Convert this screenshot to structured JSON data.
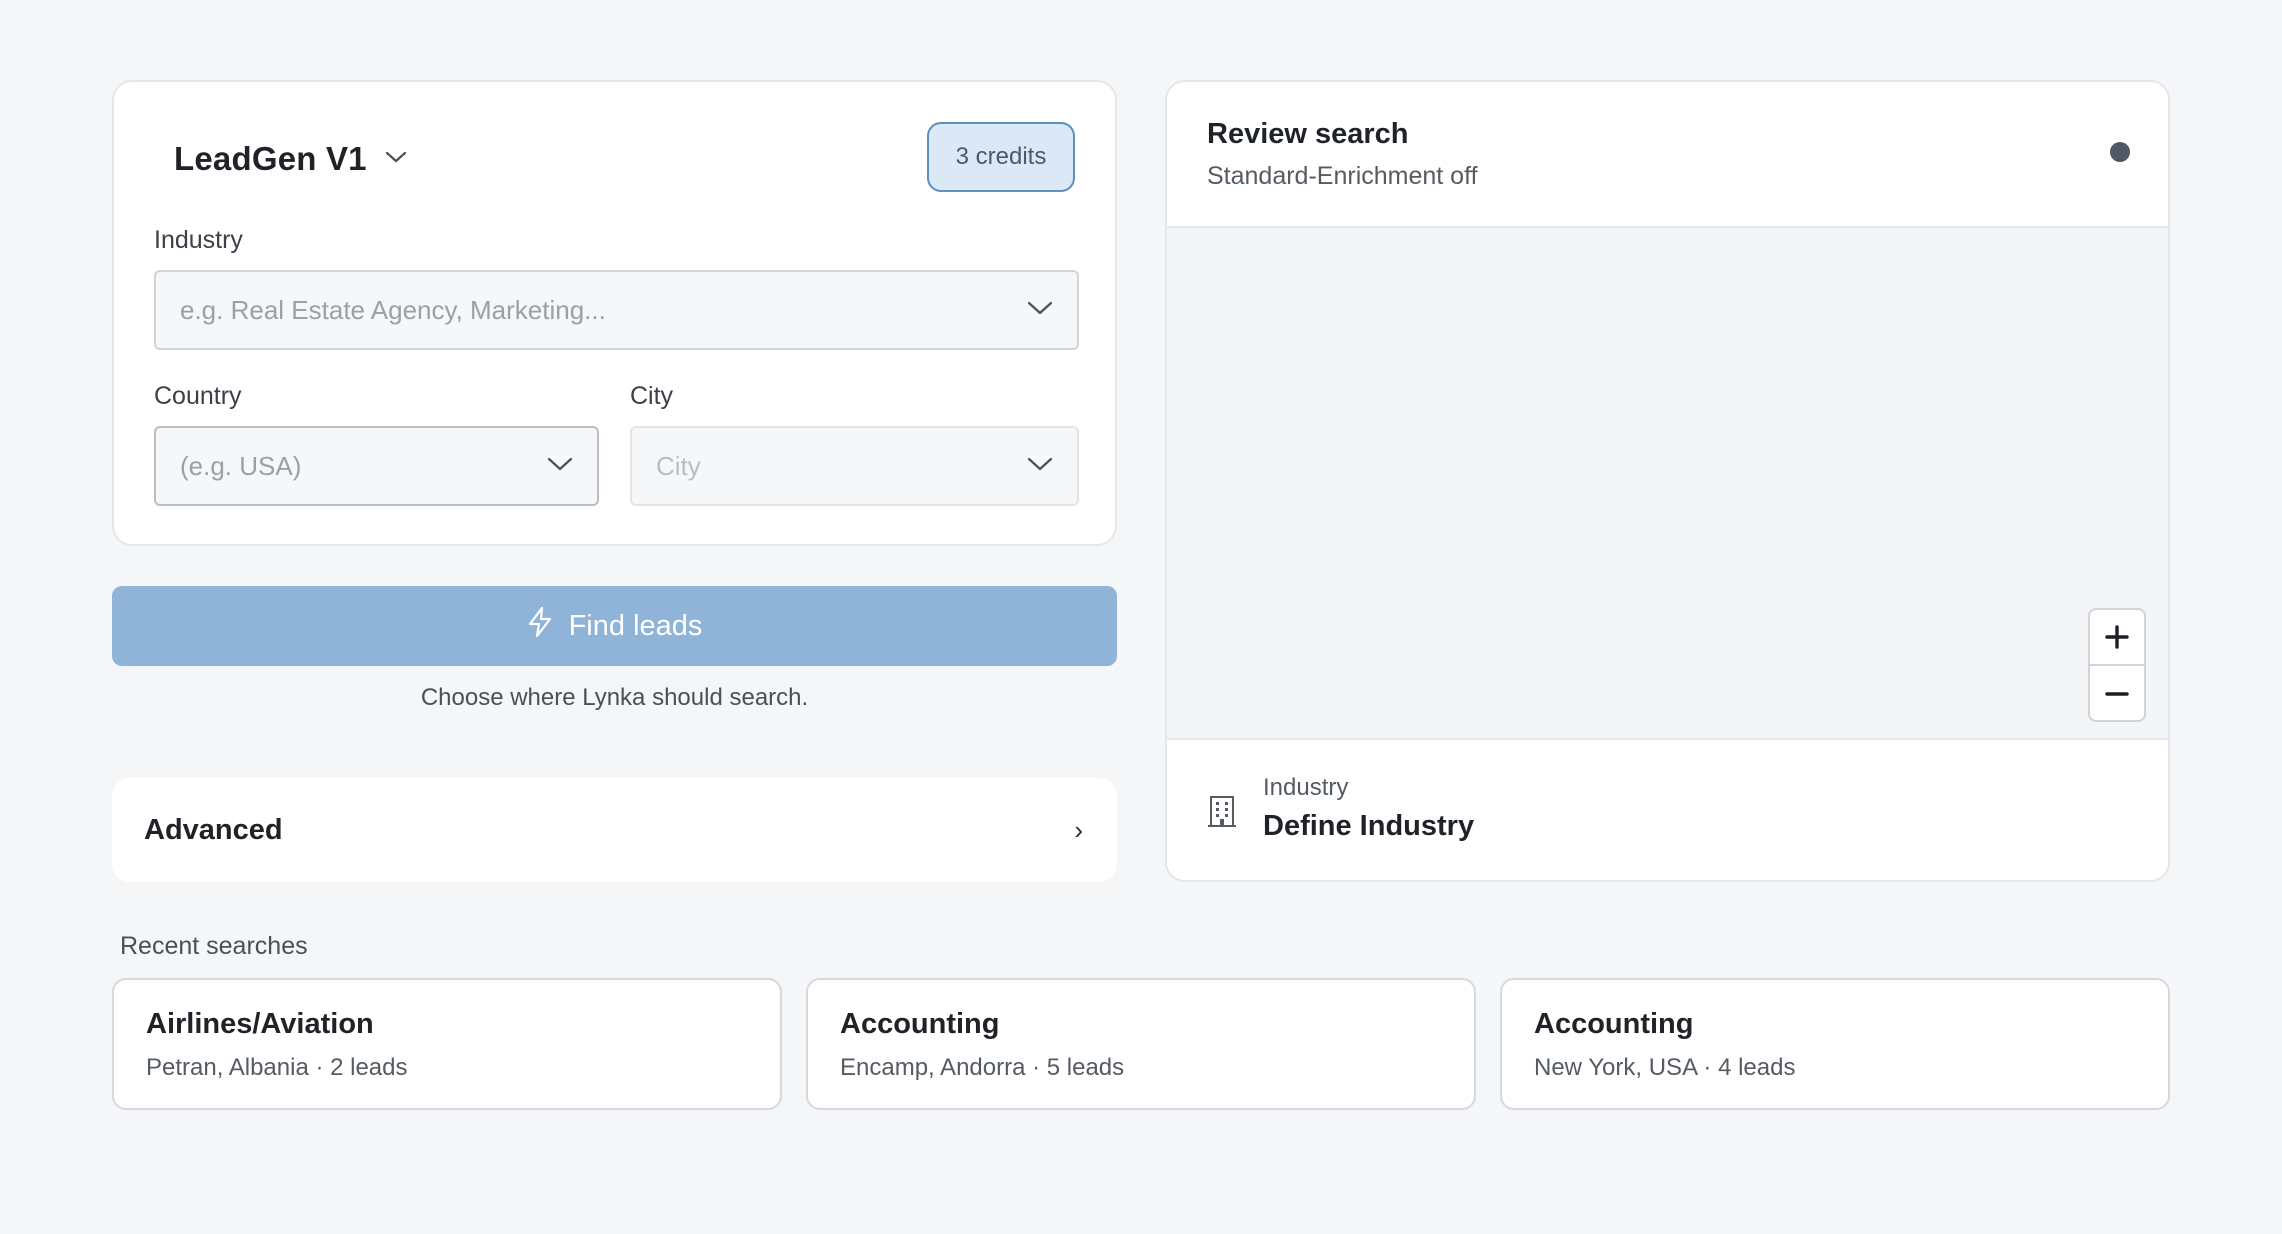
{
  "form": {
    "model_name": "LeadGen V1",
    "credits": "3 credits",
    "industry": {
      "label": "Industry",
      "placeholder": "e.g. Real Estate Agency, Marketing..."
    },
    "country": {
      "label": "Country",
      "placeholder": "(e.g. USA)"
    },
    "city": {
      "label": "City",
      "placeholder": "City"
    }
  },
  "find_leads": {
    "label": "Find leads",
    "hint": "Choose where Lynka should search."
  },
  "advanced": {
    "label": "Advanced",
    "chevron": "›"
  },
  "review": {
    "title": "Review search",
    "subtitle": "Standard-Enrichment off",
    "zoom_in": "+",
    "zoom_out": "−",
    "industry_label": "Industry",
    "industry_value": "Define Industry"
  },
  "recent": {
    "title": "Recent searches",
    "items": [
      {
        "title": "Airlines/Aviation",
        "meta": "Petran, Albania · 2 leads"
      },
      {
        "title": "Accounting",
        "meta": "Encamp, Andorra · 5 leads"
      },
      {
        "title": "Accounting",
        "meta": "New York,  USA · 4 leads"
      }
    ]
  },
  "icons": {
    "model_chevron": "chevron-down-icon",
    "select_chevron": "chevron-down-icon",
    "find_leads": "lightning-icon",
    "industry_footer": "building-icon"
  },
  "colors": {
    "primary_button": "#8fb4d8",
    "credits_bg": "#dbe8f6",
    "credits_border": "#5e8fc2",
    "page_bg": "#f4f6f8"
  }
}
